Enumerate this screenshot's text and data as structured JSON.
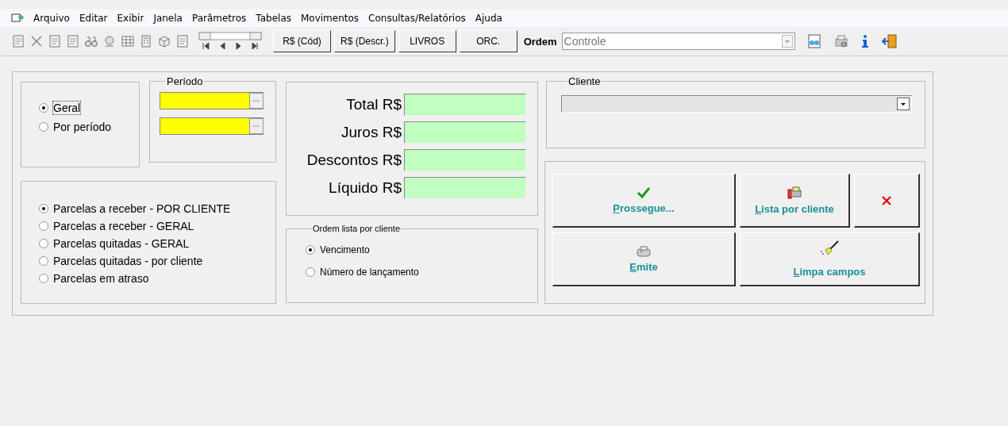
{
  "menu": [
    "Arquivo",
    "Editar",
    "Exibir",
    "Janela",
    "Parâmetros",
    "Tabelas",
    "Movimentos",
    "Consultas/Relatórios",
    "Ajuda"
  ],
  "toolbar": {
    "buttons": [
      "R$ (Cód)",
      "R$ (Descr.)",
      "LIVROS",
      "ORC."
    ],
    "order_label": "Ordem",
    "order_value": "Controle"
  },
  "scope": [
    {
      "label": "Geral",
      "selected": true
    },
    {
      "label": "Por período",
      "selected": false
    }
  ],
  "period": {
    "title": "Período"
  },
  "totals": [
    "Total R$",
    "Juros R$",
    "Descontos R$",
    "Líquido R$"
  ],
  "reports": [
    {
      "label": "Parcelas a receber - POR CLIENTE",
      "selected": true
    },
    {
      "label": "Parcelas a receber - GERAL",
      "selected": false
    },
    {
      "label": "Parcelas quitadas - GERAL",
      "selected": false
    },
    {
      "label": "Parcelas quitadas - por cliente",
      "selected": false
    },
    {
      "label": "Parcelas em atraso",
      "selected": false
    }
  ],
  "order": {
    "title": "Ordem lista por cliente",
    "options": [
      {
        "label": "Vencimento",
        "selected": true
      },
      {
        "label": "Número de lançamento",
        "selected": false
      }
    ]
  },
  "client": {
    "title": "Cliente"
  },
  "actions": [
    {
      "kind": "check",
      "label": "Prossegue..."
    },
    {
      "kind": "list",
      "label": "Lista por cliente"
    },
    {
      "kind": "close"
    },
    {
      "kind": "print",
      "label": "Emite"
    },
    {
      "kind": "broom",
      "label": "Limpa campos"
    }
  ]
}
